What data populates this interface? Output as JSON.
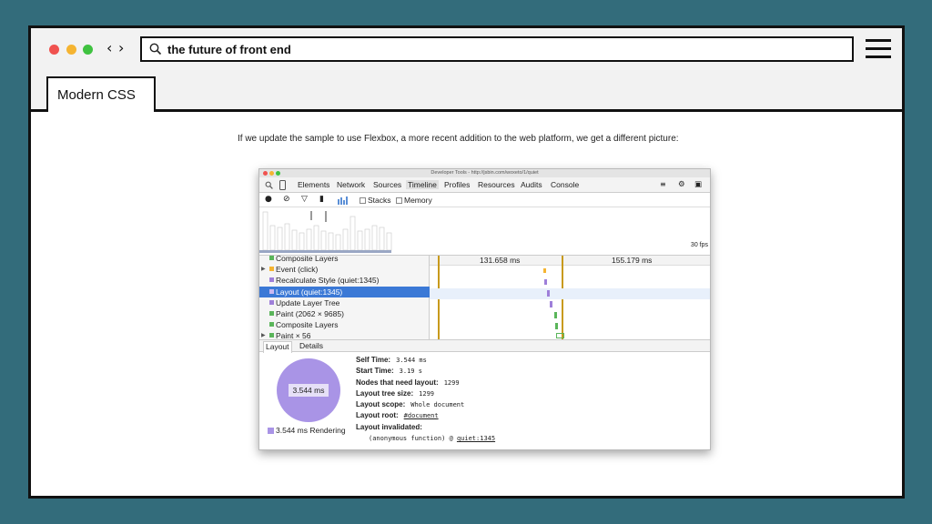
{
  "browser": {
    "search_query": "the future of front end",
    "tab_label": "Modern CSS"
  },
  "colors": {
    "page_bg": "#336c7b",
    "selection": "#3b79d6",
    "layout_purple": "#a994e6",
    "dot_red": "#f0524f",
    "dot_yellow": "#f5b431",
    "dot_green": "#3fc240"
  },
  "icons": [
    "back-arrow-icon",
    "forward-arrow-icon",
    "search-icon",
    "hamburger-menu-icon"
  ],
  "content": {
    "caption": "If we update the sample to use Flexbox, a more recent addition to the web platform, we get a different picture:"
  },
  "devtools": {
    "window_title": "Developer Tools - http://jsbin.com/woxeto/1/quiet",
    "tabs": [
      "Elements",
      "Network",
      "Sources",
      "Timeline",
      "Profiles",
      "Resources",
      "Audits",
      "Console"
    ],
    "active_tab": "Timeline",
    "toolbar": {
      "stacks_label": "Stacks",
      "memory_label": "Memory"
    },
    "fps_label": "30 fps",
    "time_markers": [
      "131.658 ms",
      "155.179 ms"
    ],
    "records": [
      {
        "label": "Composite Layers",
        "color": "#5ab55a",
        "expandable": false,
        "selected": false
      },
      {
        "label": "Event (click)",
        "color": "#f5b431",
        "expandable": true,
        "selected": false
      },
      {
        "label": "Recalculate Style (quiet:1345)",
        "color": "#9e7fd9",
        "expandable": false,
        "selected": false
      },
      {
        "label": "Layout (quiet:1345)",
        "color": "#9e7fd9",
        "expandable": false,
        "selected": true
      },
      {
        "label": "Update Layer Tree",
        "color": "#9e7fd9",
        "expandable": false,
        "selected": false
      },
      {
        "label": "Paint (2062 × 9685)",
        "color": "#5ab55a",
        "expandable": false,
        "selected": false
      },
      {
        "label": "Composite Layers",
        "color": "#5ab55a",
        "expandable": false,
        "selected": false
      },
      {
        "label": "Paint × 56",
        "color": "#5ab55a",
        "expandable": true,
        "selected": false
      }
    ],
    "bottom_tabs": [
      "Layout",
      "Details"
    ],
    "pie_label": "3.544 ms",
    "legend_label": "3.544 ms Rendering",
    "details": {
      "self_time_key": "Self Time:",
      "self_time": "3.544 ms",
      "start_time_key": "Start Time:",
      "start_time": "3.19 s",
      "nodes_key": "Nodes that need layout:",
      "nodes": "1299",
      "tree_size_key": "Layout tree size:",
      "tree_size": "1299",
      "scope_key": "Layout scope:",
      "scope": "Whole document",
      "root_key": "Layout root:",
      "root": "#document",
      "invalidated_key": "Layout invalidated:",
      "invalidated_fn": "(anonymous function) @ ",
      "invalidated_link": "quiet:1345"
    }
  }
}
